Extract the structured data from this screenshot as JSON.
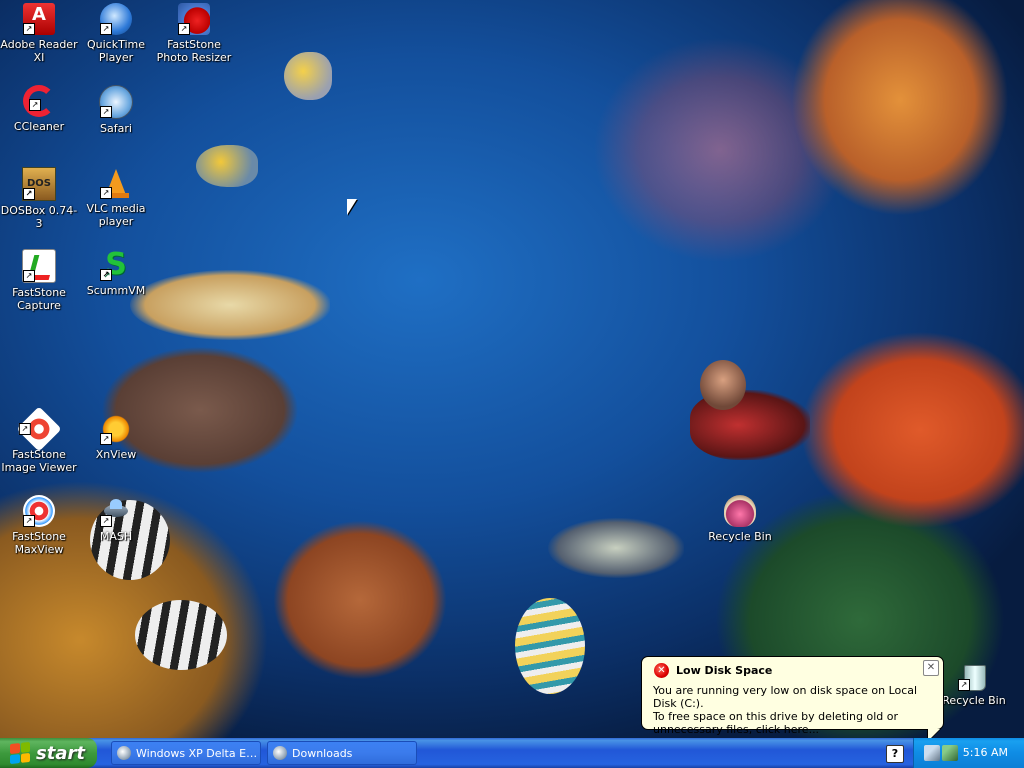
{
  "desktop": {
    "icons": [
      {
        "label": "Adobe Reader XI",
        "icon": "adobe-reader-icon"
      },
      {
        "label": "QuickTime Player",
        "icon": "quicktime-icon"
      },
      {
        "label": "FastStone Photo Resizer",
        "icon": "faststone-resizer-icon"
      },
      {
        "label": "CCleaner",
        "icon": "ccleaner-icon"
      },
      {
        "label": "Safari",
        "icon": "safari-icon"
      },
      {
        "label": "DOSBox 0.74-3",
        "icon": "dosbox-icon"
      },
      {
        "label": "VLC media player",
        "icon": "vlc-icon"
      },
      {
        "label": "FastStone Capture",
        "icon": "faststone-capture-icon"
      },
      {
        "label": "ScummVM",
        "icon": "scummvm-icon"
      },
      {
        "label": "FastStone Image Viewer",
        "icon": "faststone-viewer-icon"
      },
      {
        "label": "XnView",
        "icon": "xnview-icon"
      },
      {
        "label": "FastStone MaxView",
        "icon": "faststone-maxview-icon"
      },
      {
        "label": "MASH",
        "icon": "mash-icon"
      },
      {
        "label": "Recycle Bin",
        "icon": "recycle-bin-shell-icon"
      },
      {
        "label": "Recycle Bin",
        "icon": "recycle-bin-icon"
      }
    ],
    "dosbox_icon_text": "DOS"
  },
  "taskbar": {
    "start_label": "start",
    "tasks": [
      {
        "label": "Windows XP Delta Edi..."
      },
      {
        "label": "Downloads"
      }
    ],
    "help_glyph": "?",
    "clock": "5:16 AM"
  },
  "balloon": {
    "title": "Low Disk Space",
    "icon_glyph": "✕",
    "close_glyph": "✕",
    "line1": "You are running very low on disk space on Local Disk (C:).",
    "line2": "To free space on this drive by deleting old or unnecessary files, click here..."
  },
  "colors": {
    "taskbar_blue": "#2157d7",
    "start_green": "#3d9a3d",
    "tray_blue": "#0f8ce5",
    "balloon_bg": "#ffffe1"
  }
}
